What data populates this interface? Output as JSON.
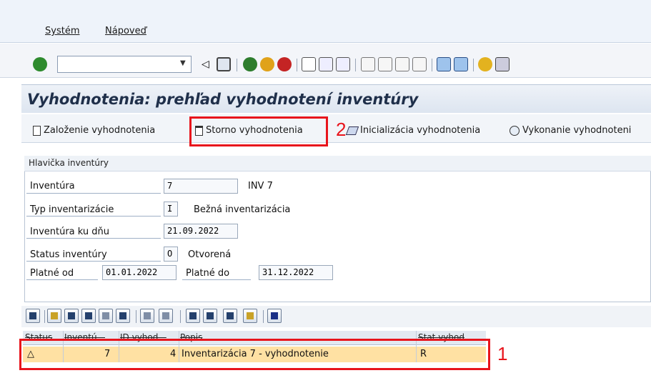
{
  "menu": {
    "system": "Systém",
    "help": "Nápoveď"
  },
  "okcode": {
    "value": ""
  },
  "page": {
    "title": "Vyhodnotenia: prehľad vyhodnotení inventúry"
  },
  "toolbar": {
    "create": "Založenie vyhodnotenia",
    "cancel": "Storno vyhodnotenia",
    "init": "Inicializácia vyhodnotenia",
    "execute": "Vykonanie vyhodnoteni"
  },
  "annotations": {
    "step1": "1",
    "step2": "2"
  },
  "header": {
    "title": "Hlavička inventúry",
    "inventory_label": "Inventúra",
    "inventory_value": "7",
    "inventory_name": "INV 7",
    "type_label": "Typ inventarizácie",
    "type_value": "I",
    "type_text": "Bežná inventarizácia",
    "date_label": "Inventúra ku dňu",
    "date_value": "21.09.2022",
    "status_label": "Status inventúry",
    "status_value": "O",
    "status_text": "Otvorená",
    "valid_from_label": "Platné od",
    "valid_from_value": "01.01.2022",
    "valid_to_label": "Platné do",
    "valid_to_value": "31.12.2022"
  },
  "grid": {
    "columns": [
      "Status",
      "Inventú...",
      "ID vyhod...",
      "Popis",
      "Stat.vyhod"
    ],
    "rows": [
      {
        "status": "△",
        "inventory": "7",
        "eval_id": "4",
        "description": "Inventarizácia 7 - vyhodnotenie",
        "eval_status": "R"
      }
    ]
  },
  "colors": {
    "accent": "#e8141c",
    "row_highlight": "#ffe1a3",
    "title": "#1f2f4a"
  }
}
